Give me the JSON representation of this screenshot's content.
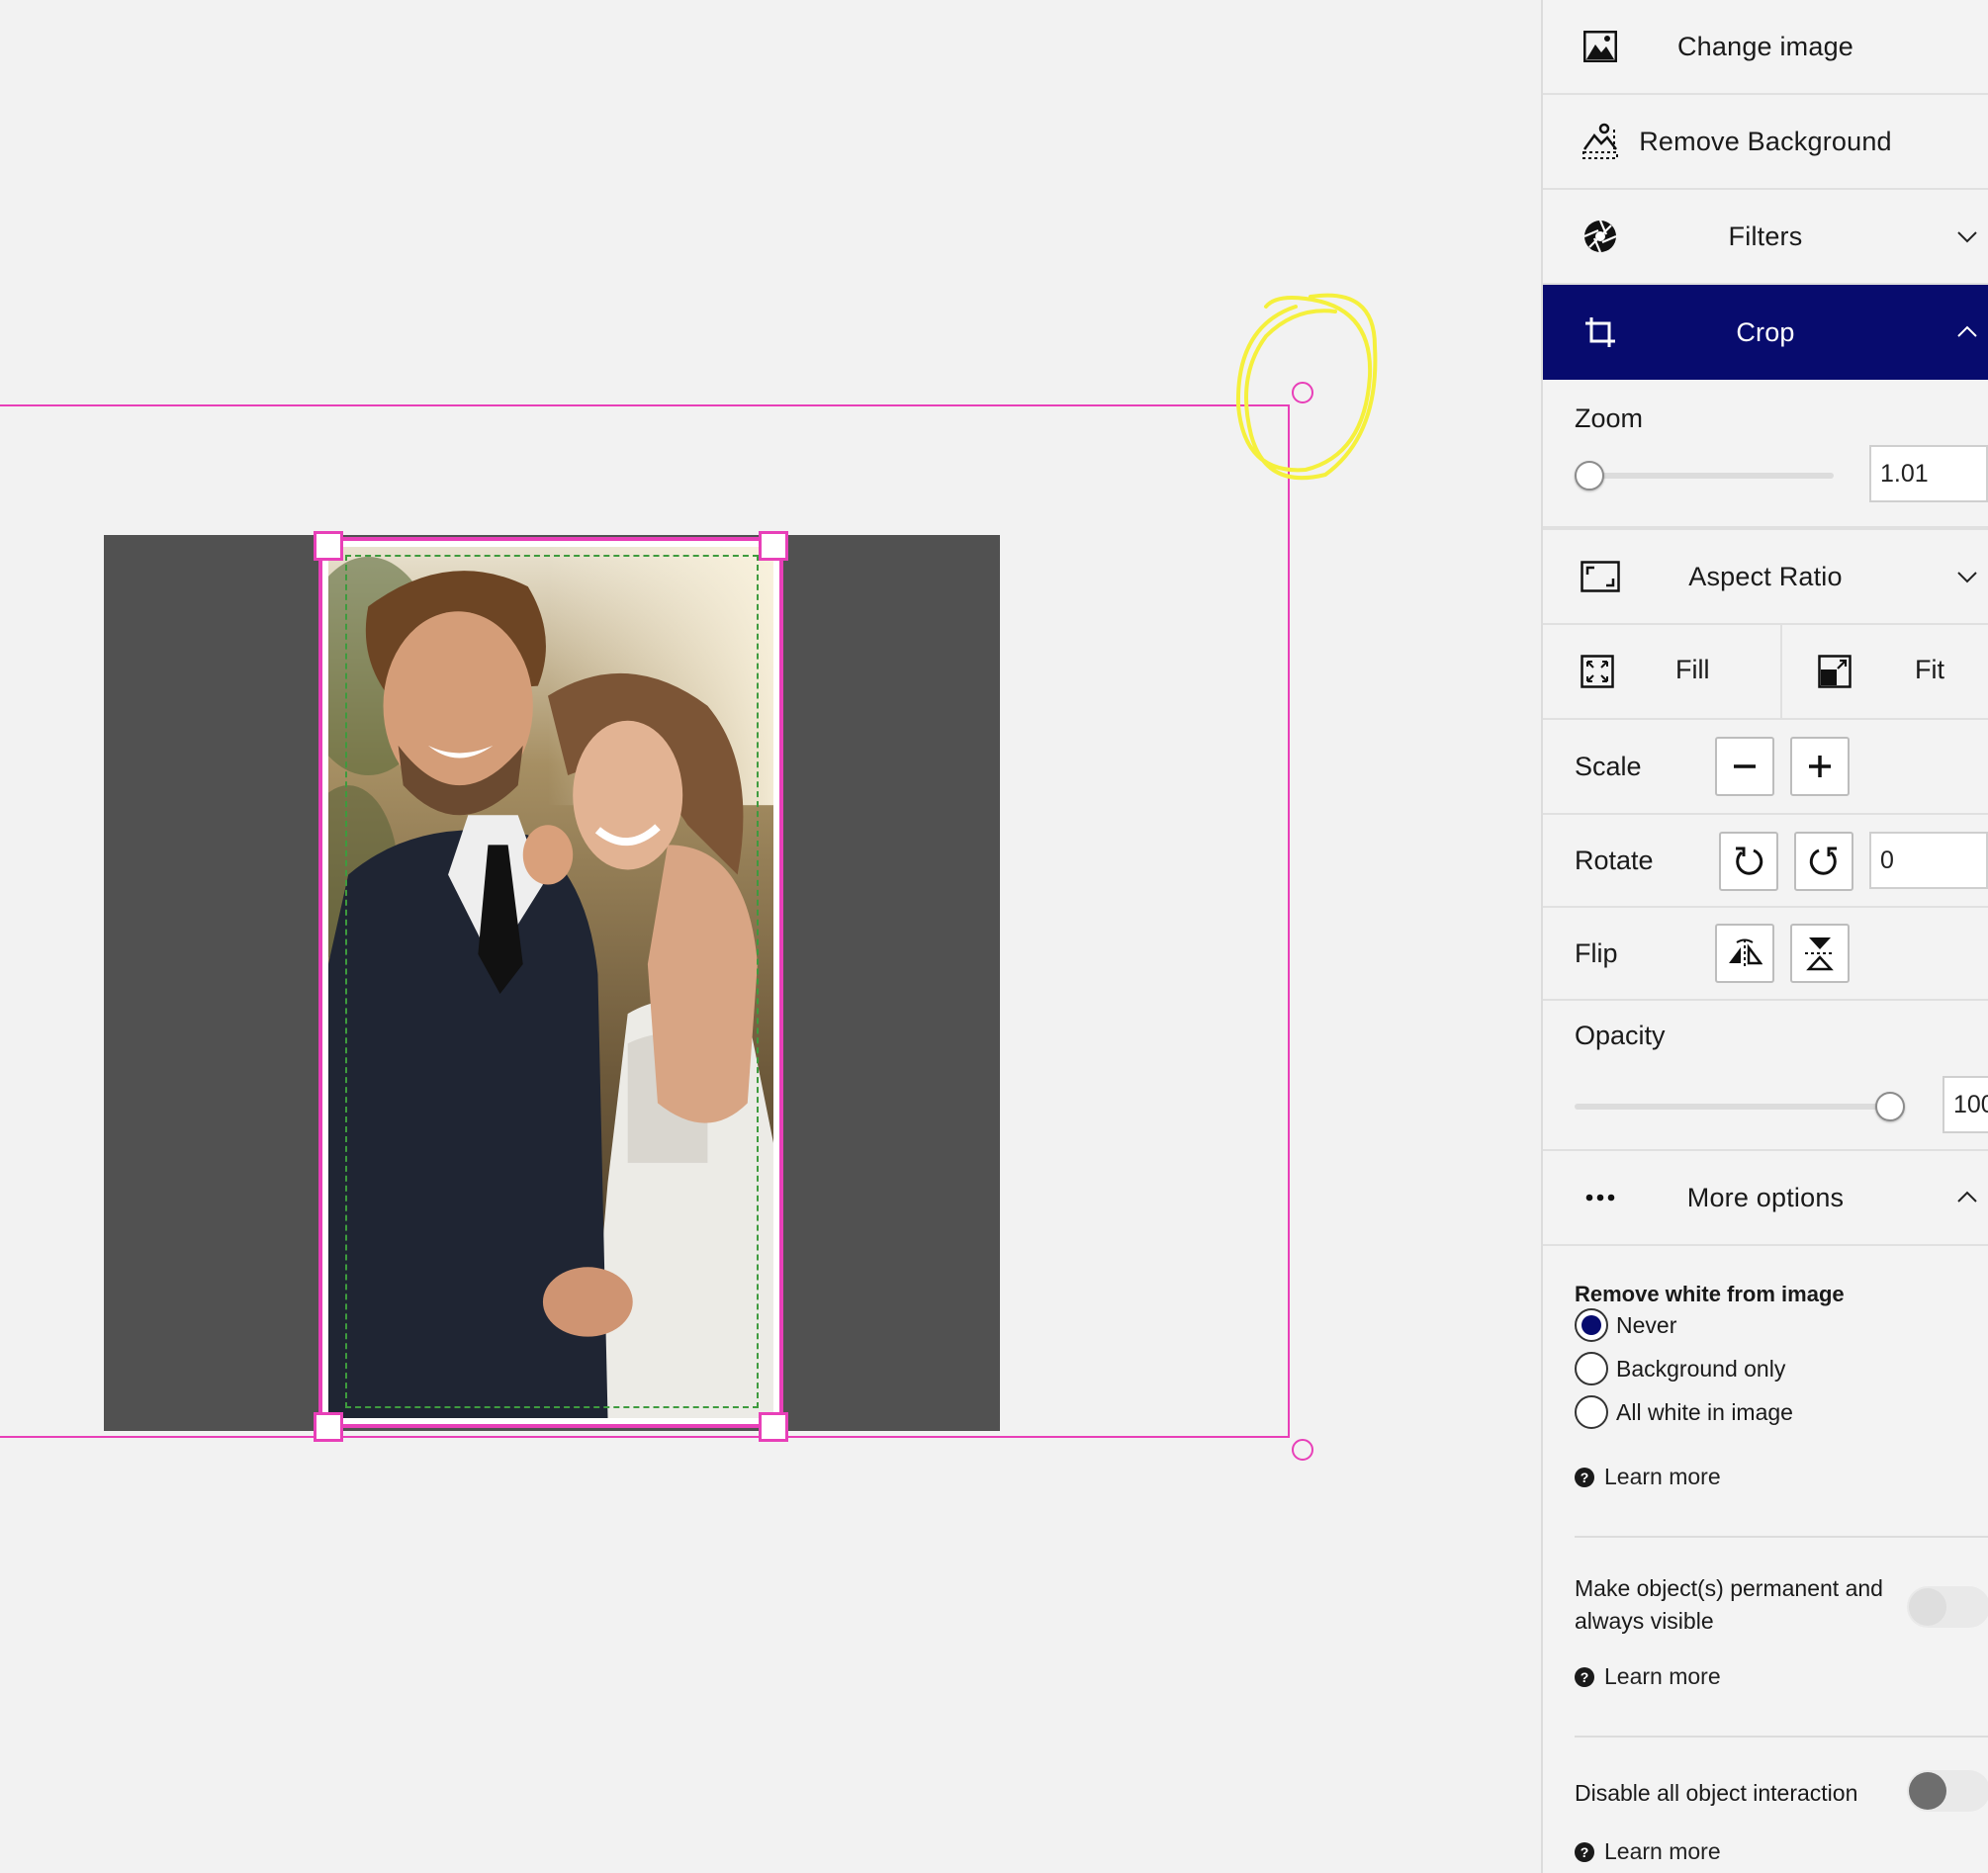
{
  "panel": {
    "change_image": "Change image",
    "remove_background": "Remove Background",
    "filters": "Filters",
    "crop": "Crop",
    "zoom_label": "Zoom",
    "zoom_value": "1.01",
    "zoom_fraction": 0.0,
    "aspect_ratio": "Aspect Ratio",
    "fill": "Fill",
    "fit": "Fit",
    "scale_label": "Scale",
    "rotate_label": "Rotate",
    "rotate_value": "0",
    "flip_label": "Flip",
    "opacity_label": "Opacity",
    "opacity_value": "100",
    "opacity_fraction": 1.0,
    "more_options": "More options",
    "remove_white_title": "Remove white from image",
    "remove_white_options": [
      "Never",
      "Background only",
      "All white in image"
    ],
    "remove_white_selected": "Never",
    "learn_more": "Learn more",
    "permanent_label": "Make object(s) permanent and always visible",
    "permanent_enabled": false,
    "disable_interaction_label": "Disable all object interaction",
    "disable_interaction_enabled": false
  },
  "colors": {
    "accent": "#070b6e",
    "selection": "#e83fb8",
    "guide": "#3e9b3e",
    "annotation": "#f5f03c",
    "canvas_dark": "#515151"
  },
  "icons": [
    "image-icon",
    "remove-background-icon",
    "aperture-icon",
    "crop-icon",
    "aspect-ratio-icon",
    "fill-icon",
    "fit-icon",
    "minus-icon",
    "plus-icon",
    "rotate-ccw-icon",
    "rotate-cw-icon",
    "flip-horizontal-icon",
    "flip-vertical-icon",
    "more-dots-icon",
    "help-icon",
    "chevron-down-icon",
    "chevron-up-icon"
  ]
}
